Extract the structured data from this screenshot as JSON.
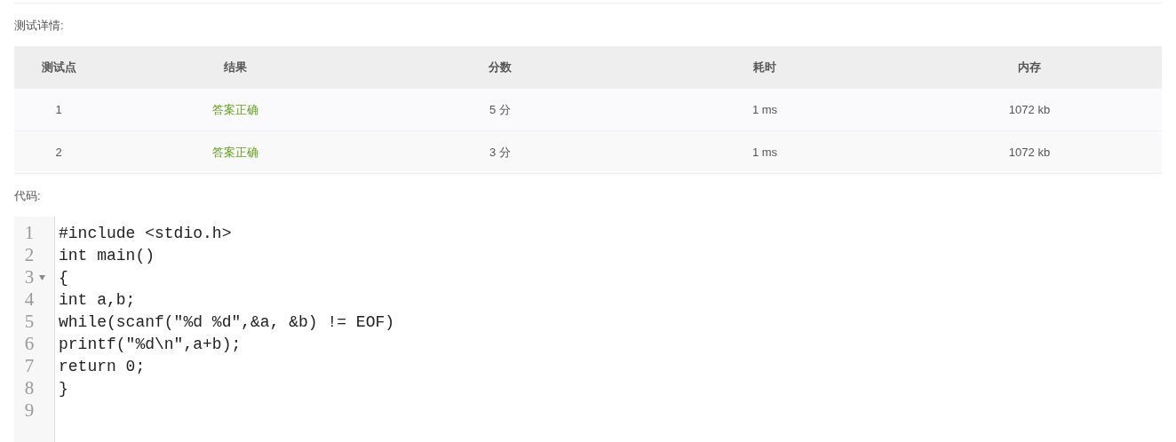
{
  "details_label": "测试详情:",
  "table": {
    "columns": [
      "测试点",
      "结果",
      "分数",
      "耗时",
      "内存"
    ],
    "rows": [
      {
        "case": "1",
        "result": "答案正确",
        "score": "5 分",
        "time": "1 ms",
        "memory": "1072 kb"
      },
      {
        "case": "2",
        "result": "答案正确",
        "score": "3 分",
        "time": "1 ms",
        "memory": "1072 kb"
      }
    ]
  },
  "code_label": "代码:",
  "code_lines": [
    {
      "number": "1",
      "code": "#include <stdio.h>",
      "foldable": false
    },
    {
      "number": "2",
      "code": "int main()",
      "foldable": false
    },
    {
      "number": "3",
      "code": "{",
      "foldable": true
    },
    {
      "number": "4",
      "code": "int a,b;",
      "foldable": false
    },
    {
      "number": "5",
      "code": "while(scanf(\"%d %d\",&a, &b) != EOF)",
      "foldable": false
    },
    {
      "number": "6",
      "code": "printf(\"%d\\n\",a+b);",
      "foldable": false
    },
    {
      "number": "7",
      "code": "return 0;",
      "foldable": false
    },
    {
      "number": "8",
      "code": "}",
      "foldable": false
    },
    {
      "number": "9",
      "foldable": false
    }
  ]
}
